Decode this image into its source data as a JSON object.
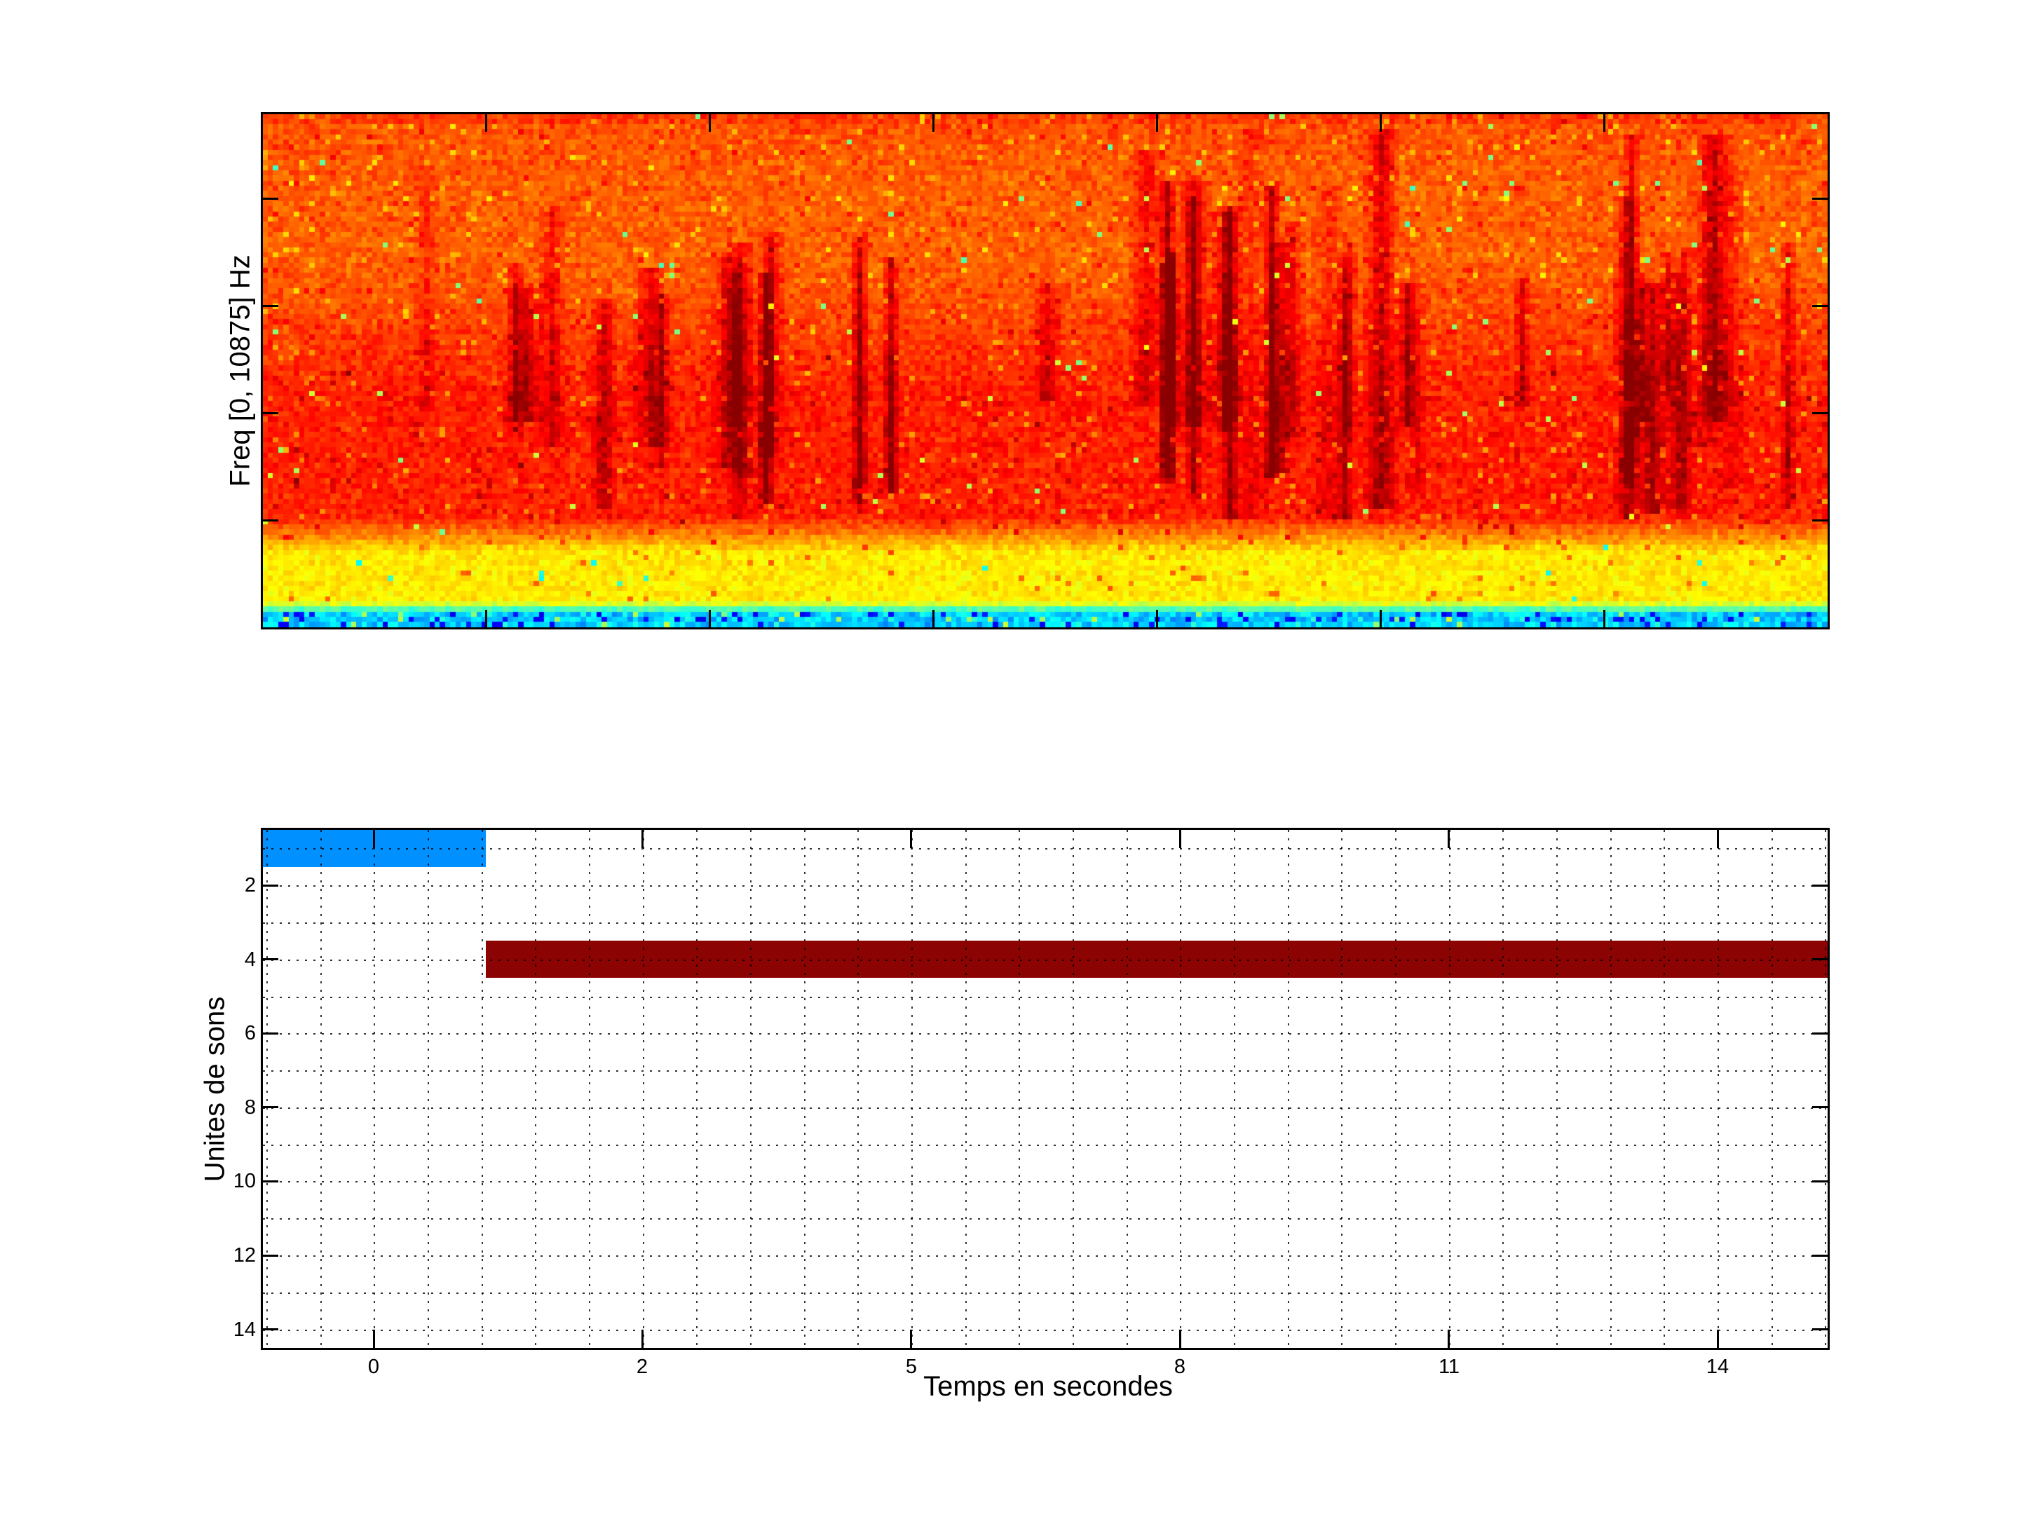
{
  "figure": {
    "background_color": "#ffffff",
    "axis_color": "#000000"
  },
  "chart_data": [
    {
      "type": "heatmap",
      "name": "spectrogram",
      "title": "",
      "xlabel": "",
      "ylabel": "Freq [0, 10875] Hz",
      "colormap": "jet",
      "x_axis": {
        "tick_labels": [],
        "tick_fracs": [
          0.1429,
          0.2857,
          0.4286,
          0.5714,
          0.7143,
          0.8571
        ]
      },
      "y_axis": {
        "tick_labels": [],
        "tick_fracs_from_top": [
          0.1647,
          0.3735,
          0.5824,
          0.7912
        ],
        "range_hz": [
          0,
          10875
        ]
      },
      "content_summary": "dense orange-red noise field; darker red vertical streaks in the middle band; bright yellow band near the bottom; thin cyan-green strip with blue dashes at the very bottom",
      "value_profile_by_depth": [
        [
          0,
          0.795
        ],
        [
          0.15,
          0.78
        ],
        [
          0.3,
          0.78
        ],
        [
          0.55,
          0.845
        ],
        [
          0.79,
          0.845
        ],
        [
          0.86,
          0.645
        ],
        [
          0.955,
          0.645
        ],
        [
          0.965,
          0.52
        ],
        [
          0.978,
          0.33
        ],
        [
          1,
          0.33
        ]
      ],
      "texture": {
        "cols": 300,
        "rows": 100,
        "noise_main": 0.055,
        "noise_bottom": 0.09,
        "n_streaks": 46,
        "seed": 9
      }
    },
    {
      "type": "bar",
      "name": "sound-units-timeline",
      "orientation": "horizontal",
      "xlabel": "Temps en secondes",
      "ylabel": "Unites de sons",
      "x_tick_labels": [
        "0",
        "2",
        "5",
        "8",
        "11",
        "14"
      ],
      "x_tick_fracs": [
        0.0708,
        0.2426,
        0.4144,
        0.5862,
        0.758,
        0.9297
      ],
      "y_tick_labels": [
        "2",
        "4",
        "6",
        "8",
        "10",
        "12",
        "14"
      ],
      "ylim": [
        0.5,
        14.5
      ],
      "y_inverted": true,
      "grid": {
        "style": "dotted",
        "v_start_frac": 0.0022,
        "v_step_frac": 0.03435,
        "v_count": 30
      },
      "bars": [
        {
          "unit": 1,
          "start_frac": 0.0,
          "end_frac": 0.1425,
          "approx_start_s": -0.8,
          "approx_end_s": 0.85,
          "color": "#0090ff"
        },
        {
          "unit": 4,
          "start_frac": 0.1425,
          "end_frac": 1.0,
          "approx_start_s": 0.85,
          "approx_end_s": 15.2,
          "color": "#8b0303"
        }
      ]
    }
  ]
}
